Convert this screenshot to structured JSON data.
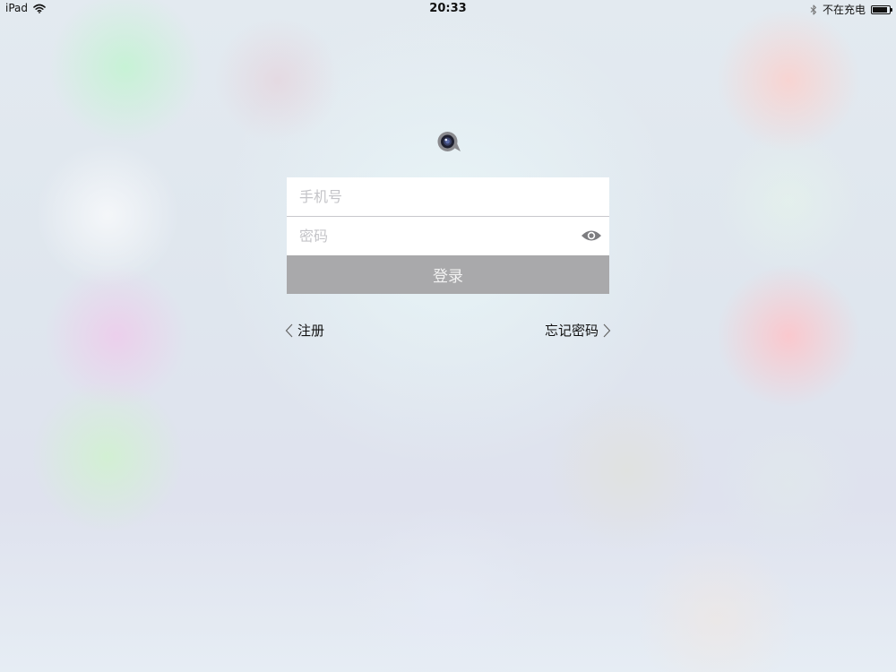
{
  "status_bar": {
    "device": "iPad",
    "time": "20:33",
    "charging_status": "不在充电",
    "battery_level": 0.9,
    "icons": [
      "wifi-icon",
      "bluetooth-icon",
      "battery-icon"
    ]
  },
  "logo": {
    "icon": "camera-lens-logo-icon"
  },
  "login_form": {
    "phone_placeholder": "手机号",
    "phone_value": "",
    "password_placeholder": "密码",
    "password_value": "",
    "show_password_icon": "eye-icon",
    "login_label": "登录"
  },
  "links": {
    "register_label": "注册",
    "forgot_password_label": "忘记密码"
  },
  "colors": {
    "login_button_bg": "#a9a9ab",
    "login_button_text": "#f2f2f2",
    "placeholder": "#c4c4c8",
    "icon_gray": "#7d7d80"
  }
}
